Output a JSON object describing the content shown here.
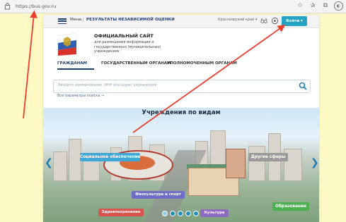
{
  "browser": {
    "url": "https://bus.gov.ru",
    "icons": [
      "lock-icon",
      "star-icon",
      "favorites-icon",
      "tab-collections-icon",
      "profile-icon"
    ]
  },
  "topnav": {
    "menu_label": "Меню",
    "results_label": "РЕЗУЛЬТАТЫ НЕЗАВИСИМОЙ ОЦЕНКИ",
    "region": "Красноярский край ▾",
    "login_label": "Войти ▾"
  },
  "header": {
    "title": "ОФИЦИАЛЬНЫЙ САЙТ",
    "subtitle": "для размещения информации о государственных (муниципальных) учреждениях"
  },
  "tabs": [
    {
      "label": "ГРАЖДАНАМ"
    },
    {
      "label": "ГОСУДАРСТВЕННЫМ ОРГАНАМ"
    },
    {
      "label": "УПОЛНОМОЧЕННЫМ ОРГАНАМ"
    }
  ],
  "search": {
    "placeholder": "Введите наименование, ИНН или адрес учреждения",
    "all_params": "Все параметры поиска →"
  },
  "hero": {
    "title": "Учреждения по видам",
    "categories": [
      {
        "label": "Социальное обеспечение",
        "color": "#3fa7d6"
      },
      {
        "label": "Другие сферы",
        "color": "#9a9a9a"
      },
      {
        "label": "Физкультура и спорт",
        "color": "#6f6ec7"
      },
      {
        "label": "Здравоохранение",
        "color": "#d9534f"
      },
      {
        "label": "Культура",
        "color": "#8e6bbf"
      },
      {
        "label": "Образование",
        "color": "#4caf50"
      }
    ],
    "prev_arrow": "❮",
    "next_arrow": "❯",
    "slide_count": 5,
    "active_slide": 1
  },
  "colors": {
    "brand_blue": "#1f3e74",
    "login_button": "#24a3c3",
    "annotation_arrow": "#e8402f",
    "background": "#fdf9c4"
  }
}
